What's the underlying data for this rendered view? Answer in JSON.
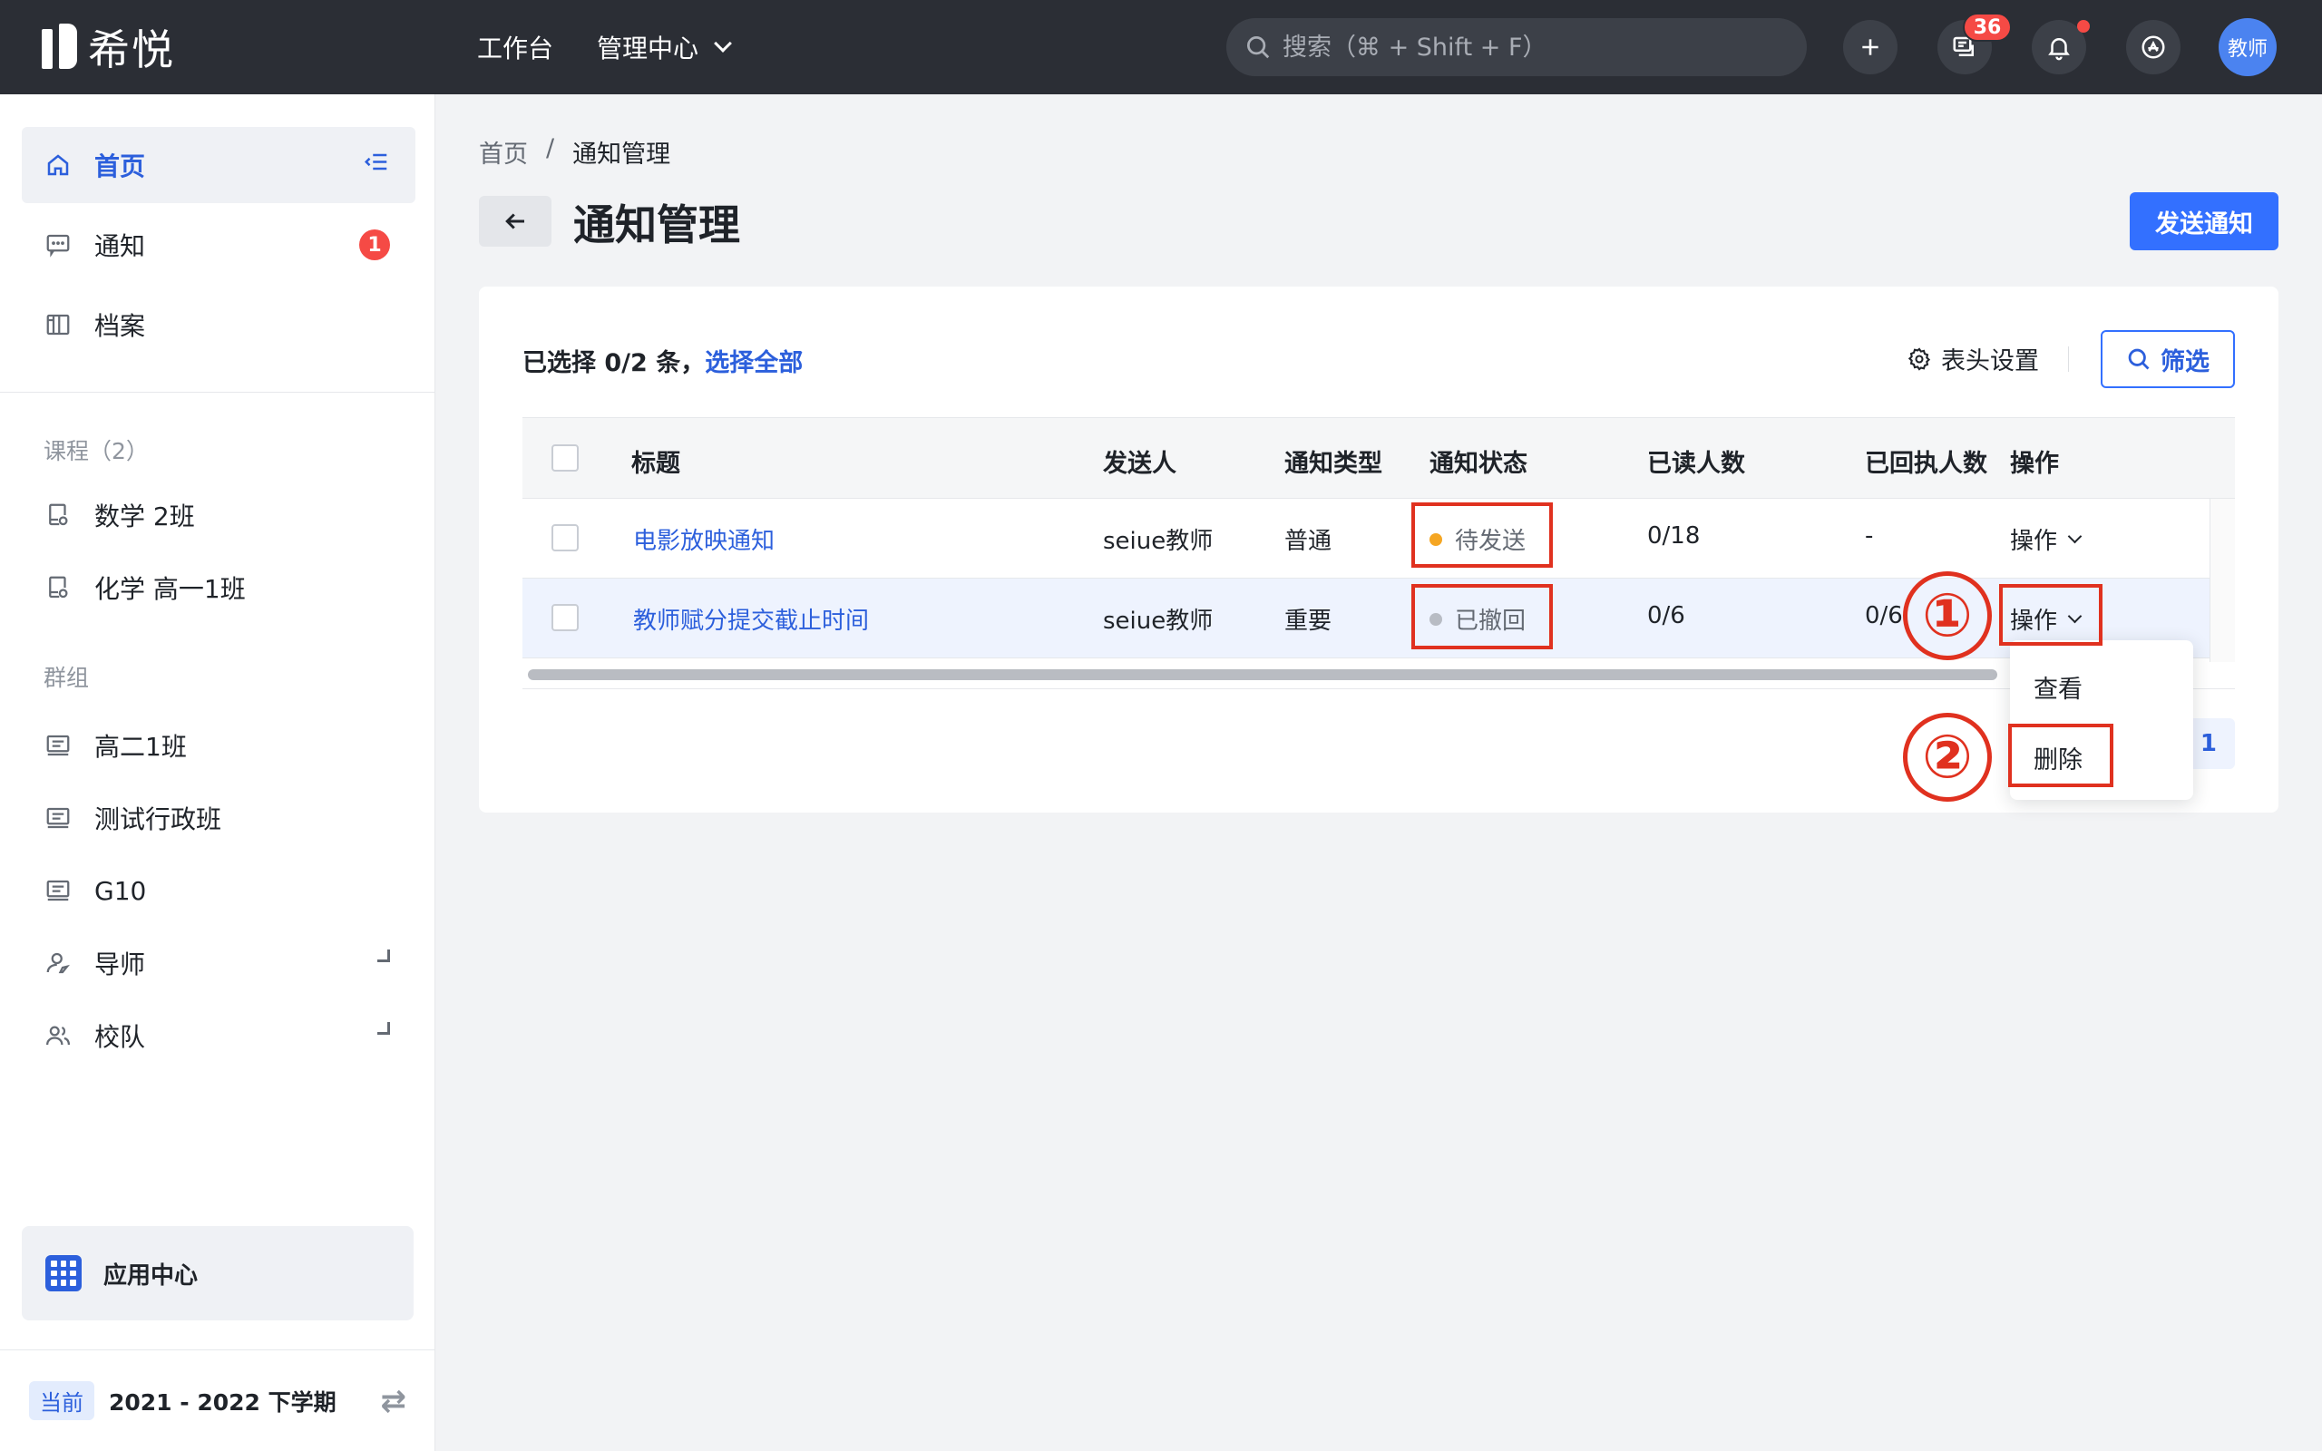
{
  "topbar": {
    "logo_text": "希悦",
    "nav": [
      "工作台",
      "管理中心"
    ],
    "search_placeholder": "搜索（⌘ + Shift + F）",
    "message_count": "36",
    "avatar_label": "教师"
  },
  "sidebar": {
    "items": [
      {
        "label": "首页",
        "icon": "home-icon"
      },
      {
        "label": "通知",
        "icon": "message-icon",
        "badge": "1"
      },
      {
        "label": "档案",
        "icon": "archive-icon"
      }
    ],
    "course_group": "课程（2）",
    "courses": [
      "数学 2班",
      "化学 高一1班"
    ],
    "group_title": "群组",
    "groups": [
      "高二1班",
      "测试行政班",
      "G10",
      "导师",
      "校队"
    ],
    "app_center": "应用中心",
    "term_tag": "当前",
    "term": "2021 - 2022 下学期"
  },
  "main": {
    "breadcrumb": [
      "首页",
      "/",
      "通知管理"
    ],
    "title": "通知管理",
    "send_button": "发送通知",
    "selection_prefix": "已选择 0/2 条，",
    "select_all": "选择全部",
    "column_settings": "表头设置",
    "filter": "筛选",
    "table": {
      "headers": [
        "标题",
        "发送人",
        "通知类型",
        "通知状态",
        "已读人数",
        "已回执人数",
        "操作"
      ],
      "rows": [
        {
          "title": "电影放映通知",
          "sender": "seiue教师",
          "type": "普通",
          "status": "待发送",
          "status_color": "#f5a623",
          "read": "0/18",
          "receipt": "-",
          "action": "操作"
        },
        {
          "title": "教师赋分提交截止时间",
          "sender": "seiue教师",
          "type": "重要",
          "status": "已撤回",
          "status_color": "#b8bcc4",
          "read": "0/6",
          "receipt": "0/6",
          "action": "操作"
        }
      ]
    },
    "pagination_current": "1",
    "dropdown": [
      "查看",
      "删除"
    ]
  },
  "annotations": {
    "step1": "①",
    "step2": "②",
    "color": "#e0311f"
  },
  "colors": {
    "topbar": "#2b2e35",
    "primary": "#3370ff",
    "link": "#2c5fdc",
    "danger": "#f54a45"
  }
}
